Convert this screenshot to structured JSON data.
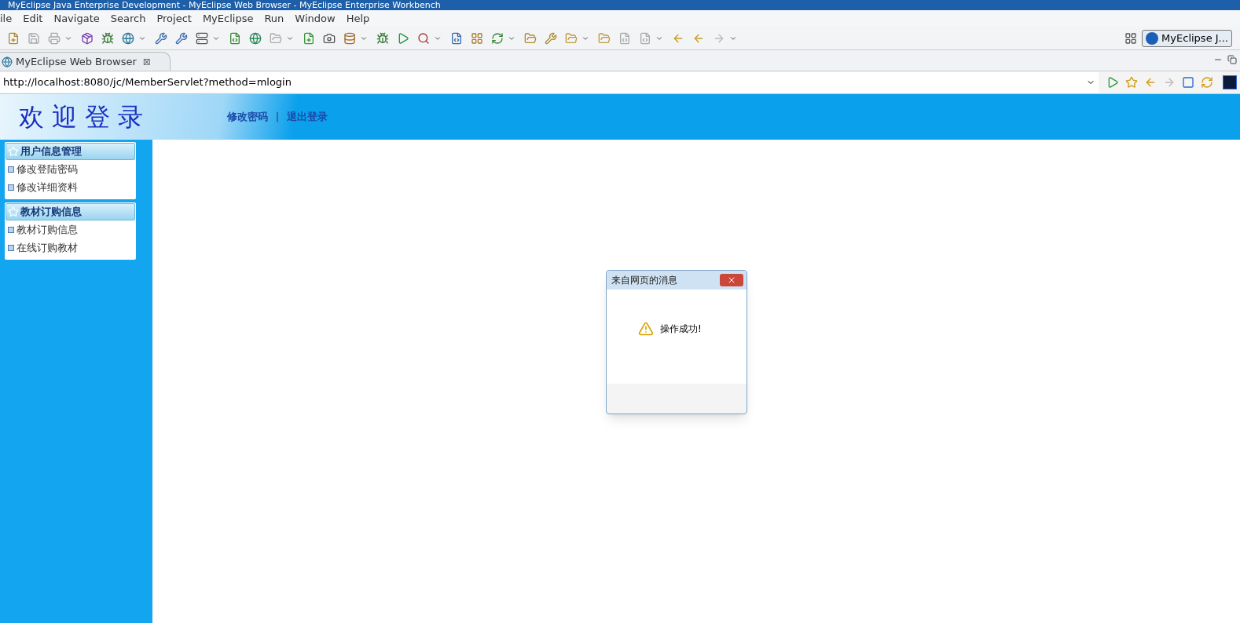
{
  "window": {
    "title": "MyEclipse Java Enterprise Development - MyEclipse Web Browser - MyEclipse Enterprise Workbench"
  },
  "menu": [
    "ile",
    "Edit",
    "Navigate",
    "Search",
    "Project",
    "MyEclipse",
    "Run",
    "Window",
    "Help"
  ],
  "perspective": {
    "label": "MyEclipse J..."
  },
  "editor_tab": {
    "label": "MyEclipse Web Browser",
    "close": "⊠"
  },
  "address": {
    "value": "http://localhost:8080/jc/MemberServlet?method=mlogin"
  },
  "page": {
    "title": "欢迎登录",
    "links": [
      "修改密码",
      "退出登录"
    ],
    "separator": "|",
    "menus": [
      {
        "title": "用户信息管理",
        "items": [
          "修改登陆密码",
          "修改详细资料"
        ]
      },
      {
        "title": "教材订购信息",
        "items": [
          "教材订购信息",
          "在线订购教材"
        ]
      }
    ]
  },
  "dialog": {
    "title": "来自网页的消息",
    "message": "操作成功!"
  }
}
